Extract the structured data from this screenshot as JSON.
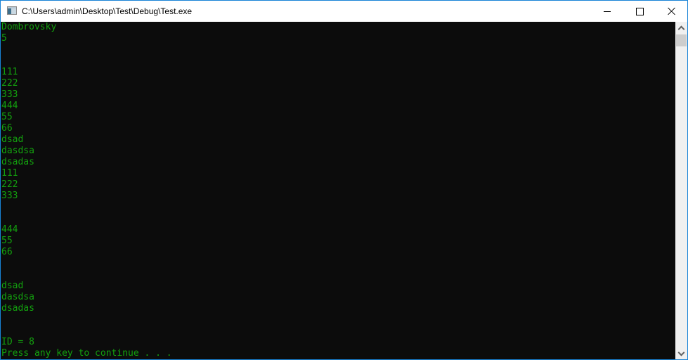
{
  "window": {
    "title": "C:\\Users\\admin\\Desktop\\Test\\Debug\\Test.exe",
    "icon": "console-app-icon",
    "controls": [
      "minimize",
      "maximize",
      "close"
    ]
  },
  "console": {
    "text_color": "#13a10e",
    "background": "#0c0c0c",
    "lines": [
      "Dombrovsky",
      "5",
      "",
      "",
      "111",
      "222",
      "333",
      "444",
      "55",
      "66",
      "dsad",
      "dasdsa",
      "dsadas",
      "111",
      "222",
      "333",
      "",
      "",
      "444",
      "55",
      "66",
      "",
      "",
      "dsad",
      "dasdsa",
      "dsadas",
      "",
      "",
      "ID = 8",
      "Press any key to continue . . ."
    ]
  },
  "scrollbar": {
    "position_fraction": 0.0
  }
}
